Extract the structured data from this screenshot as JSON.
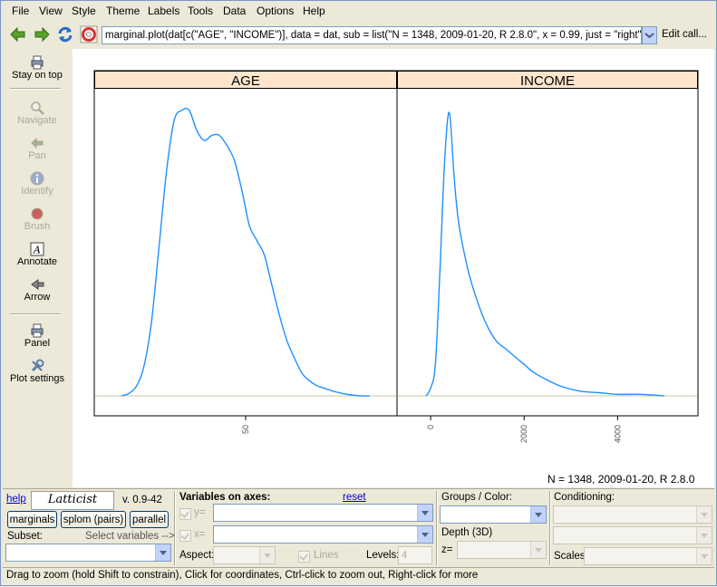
{
  "menubar": {
    "items": [
      "File",
      "View",
      "Style",
      "Theme",
      "Labels",
      "Tools",
      "Data",
      "Options",
      "Help"
    ]
  },
  "toolbar": {
    "call_text": "marginal.plot(dat[c(\"AGE\", \"INCOME\")], data = dat, sub = list(\"N = 1348, 2009-01-20, R 2.8.0\", x = 0.99, just = \"right\", c",
    "edit_call_label": "Edit call...",
    "icons": [
      "back-arrow-icon",
      "forward-arrow-icon",
      "refresh-icon",
      "help-lifebuoy-icon"
    ]
  },
  "sidebar": {
    "items": [
      {
        "label": "Stay on top",
        "icon": "printer-icon",
        "enabled": true
      },
      {
        "label": "Navigate",
        "icon": "magnifier-icon",
        "enabled": false
      },
      {
        "label": "Pan",
        "icon": "pan-icon",
        "enabled": false
      },
      {
        "label": "Identify",
        "icon": "info-icon",
        "enabled": false
      },
      {
        "label": "Brush",
        "icon": "brush-icon",
        "enabled": false
      },
      {
        "label": "Annotate",
        "icon": "annotate-icon",
        "enabled": true
      },
      {
        "label": "Arrow",
        "icon": "arrow-icon",
        "enabled": true
      },
      {
        "label": "Panel",
        "icon": "panel-icon",
        "enabled": true
      },
      {
        "label": "Plot settings",
        "icon": "tools-icon",
        "enabled": true
      }
    ]
  },
  "chart_data": {
    "type": "line",
    "subtitle": "N = 1348, 2009-01-20, R 2.8.0",
    "panels": [
      {
        "name": "AGE",
        "xticks": [
          "50"
        ],
        "series": [
          {
            "x": [
              17,
              19,
              21,
              23,
              25,
              27,
              29,
              31,
              33,
              35,
              37,
              39,
              41,
              43,
              45,
              47,
              49,
              51,
              53,
              55,
              57,
              59,
              61,
              63,
              65,
              67,
              69,
              71,
              73,
              75,
              77,
              79,
              81,
              83
            ],
            "y": [
              0.0,
              0.0005,
              0.002,
              0.006,
              0.015,
              0.03,
              0.045,
              0.055,
              0.057,
              0.057,
              0.053,
              0.051,
              0.052,
              0.052,
              0.05,
              0.047,
              0.041,
              0.034,
              0.031,
              0.028,
              0.022,
              0.016,
              0.011,
              0.0075,
              0.0045,
              0.003,
              0.002,
              0.0015,
              0.001,
              0.0006,
              0.0003,
              0.0001,
              0.0,
              0.0
            ]
          }
        ]
      },
      {
        "name": "INCOME",
        "xticks": [
          "0",
          "2000",
          "4000"
        ],
        "series": [
          {
            "x": [
              -100,
              0,
              100,
              200,
              300,
              400,
              500,
              600,
              800,
              1000,
              1200,
              1400,
              1600,
              1800,
              2000,
              2200,
              2500,
              2800,
              3200,
              3600,
              4000,
              4500,
              5000
            ],
            "y": [
              0.0,
              5e-05,
              0.0002,
              0.0008,
              0.0015,
              0.0018,
              0.0014,
              0.0011,
              0.0008,
              0.0006,
              0.00045,
              0.00035,
              0.0003,
              0.00025,
              0.0002,
              0.00015,
              0.0001,
              6e-05,
              3e-05,
              2e-05,
              1e-05,
              1e-05,
              0.0
            ]
          }
        ]
      }
    ]
  },
  "bottom": {
    "help_link": "help",
    "logo_text": "Latticist",
    "version": "v. 0.9-42",
    "buttons": {
      "marginals": "marginals",
      "splom": "splom (pairs)",
      "parallel": "parallel"
    },
    "subset_label": "Subset:",
    "select_vars_hint": "Select variables -->",
    "vars_header": "Variables on axes:",
    "reset_link": "reset",
    "y_label": "y=",
    "x_label": "x=",
    "aspect_label": "Aspect:",
    "lines_label": "Lines",
    "levels_label": "Levels:",
    "levels_value": "4",
    "groups_label": "Groups / Color:",
    "depth_label": "Depth (3D)",
    "z_label": "z=",
    "conditioning_label": "Conditioning:",
    "scales_label": "Scales:"
  },
  "statusbar": {
    "text": "Drag to zoom (hold Shift to constrain), Click for coordinates, Ctrl-click to zoom out, Right-click for more"
  },
  "colors": {
    "curve": "#1e90ff",
    "strip": "#ffe5cc",
    "baseline": "#c8c8a8"
  }
}
